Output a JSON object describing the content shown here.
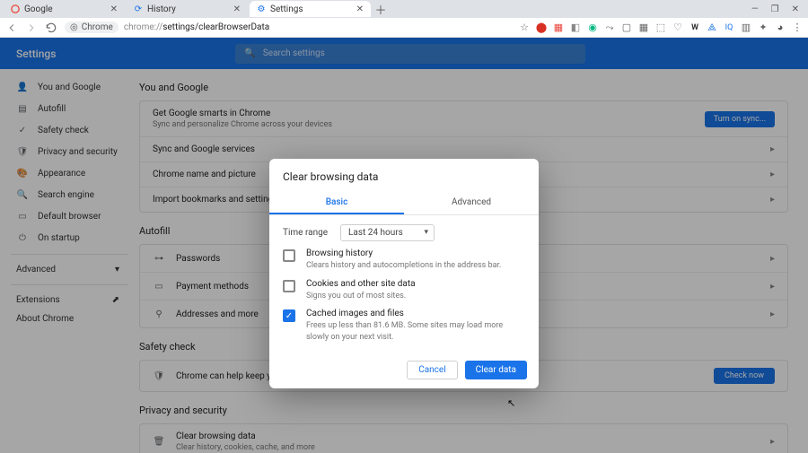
{
  "window": {
    "minimize": "—",
    "maximize": "❐",
    "close": "✕"
  },
  "tabs": [
    {
      "title": "Google",
      "favicon": "G"
    },
    {
      "title": "History",
      "favicon": "⟳"
    },
    {
      "title": "Settings",
      "favicon": "⚙"
    }
  ],
  "address": {
    "chip_label": "Chrome",
    "url_prefix": "chrome://",
    "url_path": "settings/clearBrowserData"
  },
  "bluebar": {
    "title": "Settings",
    "search_placeholder": "Search settings"
  },
  "sidebar": {
    "items": [
      {
        "label": "You and Google"
      },
      {
        "label": "Autofill"
      },
      {
        "label": "Safety check"
      },
      {
        "label": "Privacy and security"
      },
      {
        "label": "Appearance"
      },
      {
        "label": "Search engine"
      },
      {
        "label": "Default browser"
      },
      {
        "label": "On startup"
      }
    ],
    "advanced": "Advanced",
    "extensions": "Extensions",
    "about": "About Chrome"
  },
  "sections": {
    "you": {
      "heading": "You and Google",
      "smarts_title": "Get Google smarts in Chrome",
      "smarts_sub": "Sync and personalize Chrome across your devices",
      "sync_btn": "Turn on sync...",
      "rows": [
        "Sync and Google services",
        "Chrome name and picture",
        "Import bookmarks and settings"
      ]
    },
    "autofill": {
      "heading": "Autofill",
      "rows": [
        "Passwords",
        "Payment methods",
        "Addresses and more"
      ]
    },
    "safety": {
      "heading": "Safety check",
      "text": "Chrome can help keep you safe from data breaches, bad extensions, and more",
      "btn": "Check now"
    },
    "privacy": {
      "heading": "Privacy and security",
      "row_title": "Clear browsing data",
      "row_sub": "Clear history, cookies, cache, and more"
    }
  },
  "modal": {
    "title": "Clear browsing data",
    "tab_basic": "Basic",
    "tab_advanced": "Advanced",
    "timerange_label": "Time range",
    "timerange_value": "Last 24 hours",
    "options": [
      {
        "title": "Browsing history",
        "desc": "Clears history and autocompletions in the address bar.",
        "checked": false
      },
      {
        "title": "Cookies and other site data",
        "desc": "Signs you out of most sites.",
        "checked": false
      },
      {
        "title": "Cached images and files",
        "desc": "Frees up less than 81.6 MB. Some sites may load more slowly on your next visit.",
        "checked": true
      }
    ],
    "cancel": "Cancel",
    "clear": "Clear data"
  }
}
